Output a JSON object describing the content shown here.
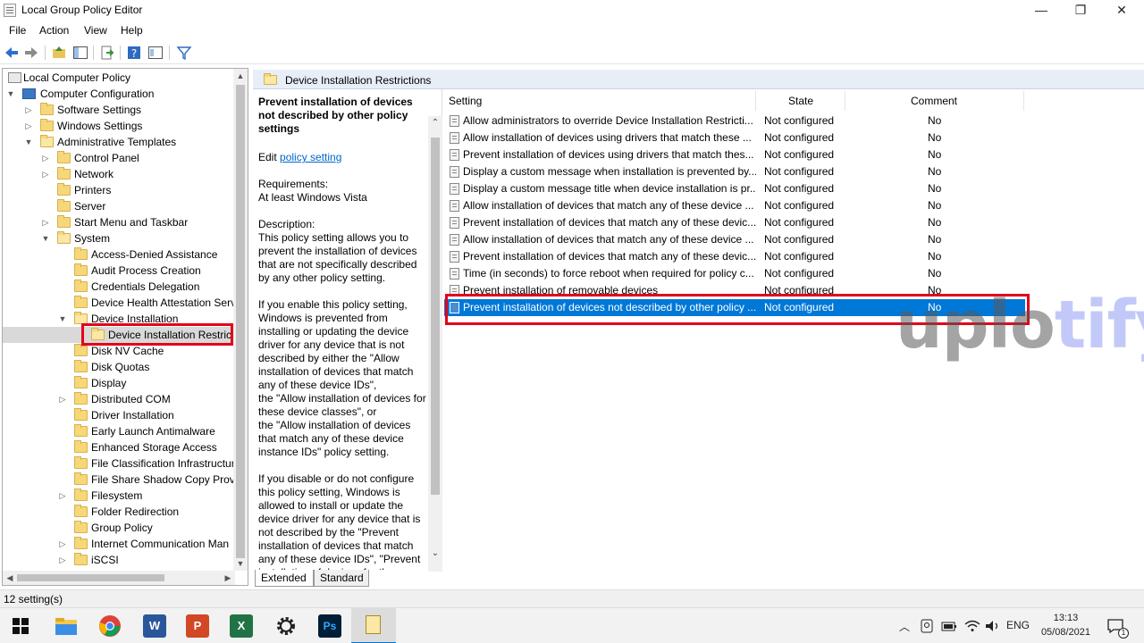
{
  "window": {
    "title": "Local Group Policy Editor",
    "minimize": "—",
    "maximize": "❐",
    "close": "✕"
  },
  "menu": [
    "File",
    "Action",
    "View",
    "Help"
  ],
  "tree": [
    {
      "label": "Local Computer Policy"
    },
    {
      "label": "Computer Configuration"
    },
    {
      "label": "Software Settings"
    },
    {
      "label": "Windows Settings"
    },
    {
      "label": "Administrative Templates"
    },
    {
      "label": "Control Panel"
    },
    {
      "label": "Network"
    },
    {
      "label": "Printers"
    },
    {
      "label": "Server"
    },
    {
      "label": "Start Menu and Taskbar"
    },
    {
      "label": "System"
    },
    {
      "label": "Access-Denied Assistance"
    },
    {
      "label": "Audit Process Creation"
    },
    {
      "label": "Credentials Delegation"
    },
    {
      "label": "Device Health Attestation Serv"
    },
    {
      "label": "Device Installation"
    },
    {
      "label": "Device Installation Restric"
    },
    {
      "label": "Disk NV Cache"
    },
    {
      "label": "Disk Quotas"
    },
    {
      "label": "Display"
    },
    {
      "label": "Distributed COM"
    },
    {
      "label": "Driver Installation"
    },
    {
      "label": "Early Launch Antimalware"
    },
    {
      "label": "Enhanced Storage Access"
    },
    {
      "label": "File Classification Infrastructur"
    },
    {
      "label": "File Share Shadow Copy Provi"
    },
    {
      "label": "Filesystem"
    },
    {
      "label": "Folder Redirection"
    },
    {
      "label": "Group Policy"
    },
    {
      "label": "Internet Communication Man"
    },
    {
      "label": "iSCSI"
    }
  ],
  "panel": {
    "header": "Device Installation Restrictions",
    "desc_title": "Prevent installation of devices not described by other policy settings",
    "edit_prefix": "Edit ",
    "edit_link": "policy setting ",
    "requirements": "Requirements:\nAt least Windows Vista",
    "description": "Description:\nThis policy setting allows you to prevent the installation of devices that are not specifically described by any other policy setting.",
    "enable_text": "If you enable this policy setting, Windows is prevented from installing or updating the device driver for any device that is not described by either the \"Allow installation of devices that match any of these device IDs\",\nthe \"Allow installation of devices for these device classes\", or\nthe \"Allow installation of devices that match any of these device instance IDs\" policy setting.",
    "disable_text": "If you disable or do not configure this policy setting, Windows is allowed to install or update the device driver for any device that is not described by the \"Prevent installation of devices that match any of these device IDs\", \"Prevent installation of devices for these"
  },
  "columns": {
    "setting": "Setting",
    "state": "State",
    "comment": "Comment"
  },
  "rows": [
    {
      "setting": "Allow administrators to override Device Installation Restricti...",
      "state": "Not configured",
      "comment": "No"
    },
    {
      "setting": "Allow installation of devices using drivers that match these ...",
      "state": "Not configured",
      "comment": "No"
    },
    {
      "setting": "Prevent installation of devices using drivers that match thes...",
      "state": "Not configured",
      "comment": "No"
    },
    {
      "setting": "Display a custom message when installation is prevented by...",
      "state": "Not configured",
      "comment": "No"
    },
    {
      "setting": "Display a custom message title when device installation is pr...",
      "state": "Not configured",
      "comment": "No"
    },
    {
      "setting": "Allow installation of devices that match any of these device ...",
      "state": "Not configured",
      "comment": "No"
    },
    {
      "setting": "Prevent installation of devices that match any of these devic...",
      "state": "Not configured",
      "comment": "No"
    },
    {
      "setting": "Allow installation of devices that match any of these device ...",
      "state": "Not configured",
      "comment": "No"
    },
    {
      "setting": "Prevent installation of devices that match any of these devic...",
      "state": "Not configured",
      "comment": "No"
    },
    {
      "setting": "Time (in seconds) to force reboot when required for policy c...",
      "state": "Not configured",
      "comment": "No"
    },
    {
      "setting": "Prevent installation of removable devices",
      "state": "Not configured",
      "comment": "No"
    },
    {
      "setting": "Prevent installation of devices not described by other policy ...",
      "state": "Not configured",
      "comment": "No"
    }
  ],
  "watermark": {
    "part1": "uplo",
    "part2": "tify"
  },
  "tabs": {
    "extended": "Extended",
    "standard": "Standard"
  },
  "status": "12 setting(s)",
  "taskbar": {
    "word": "W",
    "powerpoint": "P",
    "excel": "X",
    "photoshop": "Ps",
    "language": "ENG",
    "time": "13:13",
    "date": "05/08/2021",
    "notif_count": "1"
  },
  "colors": {
    "selection": "#0078d7",
    "highlight_box": "#e3001b",
    "link": "#0066cc"
  }
}
